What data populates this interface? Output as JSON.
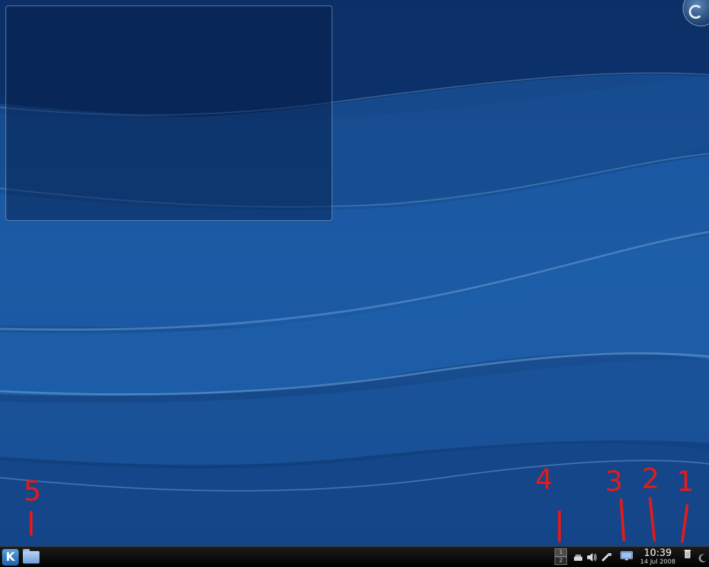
{
  "clock": {
    "time": "10:39",
    "date": "14 Jul 2008"
  },
  "pager": {
    "desktops": [
      "1",
      "2"
    ],
    "active": "1"
  },
  "annotations": {
    "taskbar_item_1": "1",
    "taskbar_item_2": "2",
    "taskbar_item_3": "3",
    "taskbar_item_4": "4",
    "taskbar_item_5": "5"
  },
  "colors": {
    "wallpaper": "#1c4f8f",
    "panel": "#000000",
    "annotation": "#e51a1a"
  },
  "icons": {
    "menu": "k-menu-icon",
    "home": "home-folder-icon",
    "pager": "desktop-pager-icon",
    "removable": "removable-device-icon",
    "volume": "volume-icon",
    "network": "network-icon",
    "show_desktop": "show-desktop-icon",
    "trash": "trash-icon",
    "toolbox": "panel-toolbox-icon",
    "desktop_toolbox": "desktop-toolbox-icon"
  }
}
